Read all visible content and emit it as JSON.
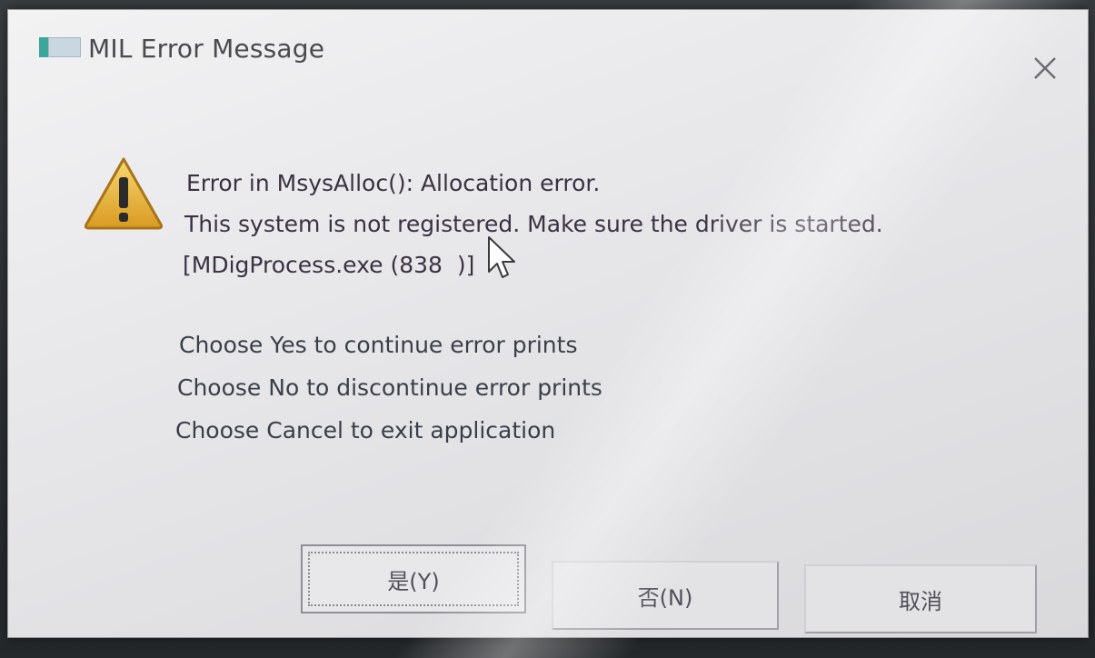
{
  "dialog": {
    "title": "MIL Error Message",
    "close_label": "×",
    "icons": {
      "app": "app-icon",
      "warning": "warning-icon",
      "close": "close-icon",
      "cursor": "mouse-cursor-icon"
    },
    "message_lines": [
      "Error in MsysAlloc(): Allocation error.",
      "This system is not registered. Make sure the driver is started.",
      "[MDigProcess.exe (838  )]"
    ],
    "choice_lines": [
      "Choose Yes to continue error prints",
      "Choose No to discontinue error prints",
      "Choose Cancel to exit application"
    ],
    "buttons": {
      "yes": "是(Y)",
      "no": "否(N)",
      "cancel": "取消"
    },
    "colors": {
      "warning_fill": "#e8b83a",
      "warning_outline": "#b07a18",
      "text": "#3a3242"
    }
  }
}
